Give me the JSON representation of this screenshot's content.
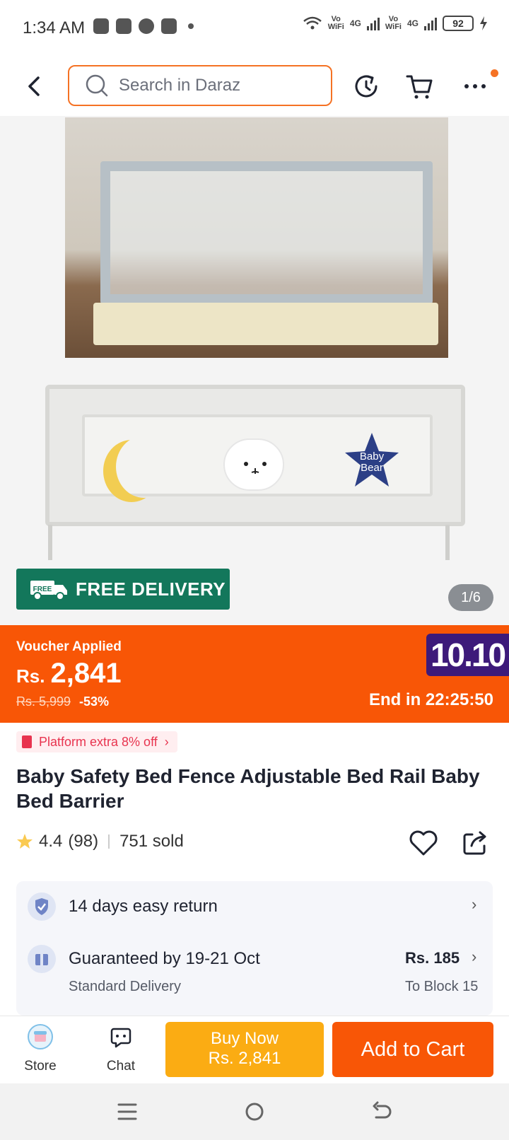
{
  "status_bar": {
    "time": "1:34 AM",
    "net1_top": "Vo",
    "net1_bottom": "WiFi",
    "net1_type": "4G",
    "net2_top": "Vo",
    "net2_bottom": "WiFi",
    "net2_type": "4G",
    "battery": "92"
  },
  "header": {
    "search_placeholder": "Search in Daraz",
    "icons": [
      "back-arrow-icon",
      "search-icon",
      "history-icon",
      "cart-icon",
      "more-icon"
    ]
  },
  "gallery": {
    "free_delivery_badge": "FREE",
    "free_delivery": "FREE DELIVERY",
    "counter": "1/6",
    "badge_text_line1": "Baby",
    "badge_text_line2": "Bear"
  },
  "price_band": {
    "voucher": "Voucher Applied",
    "currency": "Rs.",
    "price": "2,841",
    "old_price": "Rs. 5,999",
    "discount": "-53%",
    "campaign": "10.10",
    "countdown": "End in 22:25:50",
    "colors": {
      "band": "#f85606",
      "campaign_bg": "#3d1a7a"
    }
  },
  "product": {
    "platform_offer": "Platform extra 8% off",
    "title": "Baby Safety Bed Fence Adjustable Bed Rail Baby Bed Barrier",
    "rating": "4.4",
    "reviews": "(98)",
    "sold": "751 sold"
  },
  "services": {
    "return": "14 days easy return",
    "delivery": "Guaranteed by 19-21 Oct",
    "delivery_type": "Standard Delivery",
    "delivery_price": "Rs. 185",
    "delivery_to": "To Block 15"
  },
  "actions": {
    "store": "Store",
    "chat": "Chat",
    "buy_now_line1": "Buy Now",
    "buy_now_line2": "Rs. 2,841",
    "add_to_cart": "Add to Cart",
    "colors": {
      "buy_now": "#fbac13",
      "add_to_cart": "#f85606"
    }
  }
}
